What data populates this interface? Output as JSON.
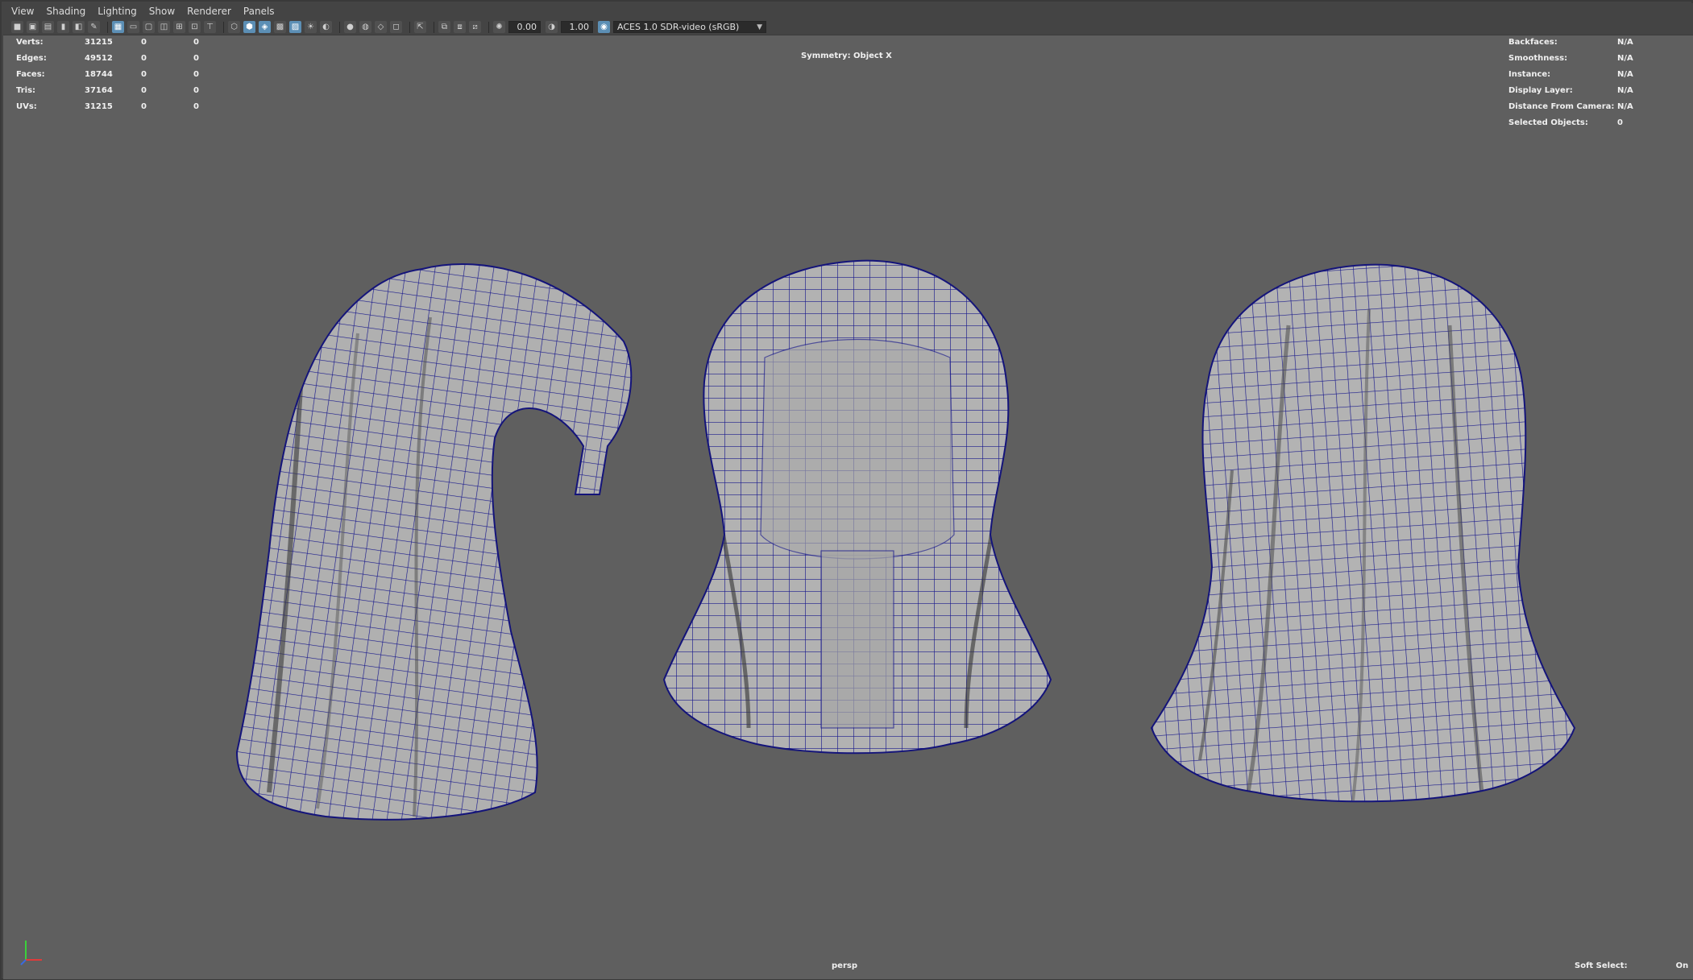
{
  "menu": [
    "View",
    "Shading",
    "Lighting",
    "Show",
    "Renderer",
    "Panels"
  ],
  "toolbar": {
    "exposure": "0.00",
    "gamma": "1.00",
    "color_space": "ACES 1.0 SDR-video (sRGB)"
  },
  "hud_left": [
    {
      "label": "Verts:",
      "v1": "31215",
      "v2": "0",
      "v3": "0"
    },
    {
      "label": "Edges:",
      "v1": "49512",
      "v2": "0",
      "v3": "0"
    },
    {
      "label": "Faces:",
      "v1": "18744",
      "v2": "0",
      "v3": "0"
    },
    {
      "label": "Tris:",
      "v1": "37164",
      "v2": "0",
      "v3": "0"
    },
    {
      "label": "UVs:",
      "v1": "31215",
      "v2": "0",
      "v3": "0"
    }
  ],
  "hud_right": [
    {
      "label": "Backfaces:",
      "value": "N/A"
    },
    {
      "label": "Smoothness:",
      "value": "N/A"
    },
    {
      "label": "Instance:",
      "value": "N/A"
    },
    {
      "label": "Display Layer:",
      "value": "N/A"
    },
    {
      "label": "Distance From Camera:",
      "value": "N/A"
    },
    {
      "label": "Selected Objects:",
      "value": "0"
    }
  ],
  "symmetry": "Symmetry: Object X",
  "camera": "persp",
  "soft_select": {
    "label": "Soft Select:",
    "value": "On"
  },
  "colors": {
    "viewport_bg": "#5f5f5f",
    "wire": "#1a1a8c",
    "mesh": "#b4b4b4"
  }
}
